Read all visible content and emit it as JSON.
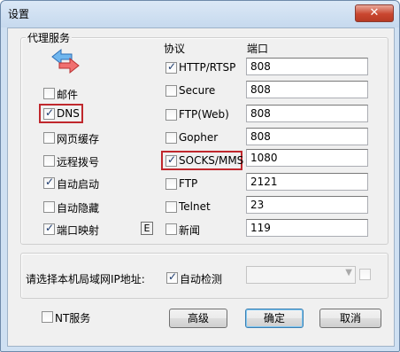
{
  "window": {
    "title": "设置",
    "close_glyph": "✕"
  },
  "proxy_group": {
    "label": "代理服务",
    "protocol_header": "协议",
    "port_header": "端口"
  },
  "left_options": [
    {
      "label": "邮件",
      "checked": false
    },
    {
      "label": "DNS",
      "checked": true
    },
    {
      "label": "网页缓存",
      "checked": false
    },
    {
      "label": "远程拨号",
      "checked": false
    },
    {
      "label": "自动启动",
      "checked": true
    },
    {
      "label": "自动隐藏",
      "checked": false
    },
    {
      "label": "端口映射",
      "checked": true
    }
  ],
  "port_mapping_edit": "E",
  "protocols": [
    {
      "label": "HTTP/RTSP",
      "checked": true,
      "port": "808"
    },
    {
      "label": "Secure",
      "checked": false,
      "port": "808"
    },
    {
      "label": "FTP(Web)",
      "checked": false,
      "port": "808"
    },
    {
      "label": "Gopher",
      "checked": false,
      "port": "808"
    },
    {
      "label": "SOCKS/MMS",
      "checked": true,
      "port": "1080"
    },
    {
      "label": "FTP",
      "checked": false,
      "port": "2121"
    },
    {
      "label": "Telnet",
      "checked": false,
      "port": "23"
    },
    {
      "label": "新闻",
      "checked": false,
      "port": "119"
    }
  ],
  "ip_section": {
    "label": "请选择本机局域网IP地址:",
    "auto_detect_label": "自动检测",
    "auto_detect_checked": true,
    "ip_value": ""
  },
  "footer": {
    "nt_service_label": "NT服务",
    "nt_service_checked": false,
    "advanced_button": "高级",
    "ok_button": "确定",
    "cancel_button": "取消"
  },
  "colors": {
    "highlight_border": "#c0282d",
    "title_bg": "#cfe0f2",
    "close_red": "#c9462f"
  },
  "icons": {
    "proxy": "double-arrow-icon"
  }
}
